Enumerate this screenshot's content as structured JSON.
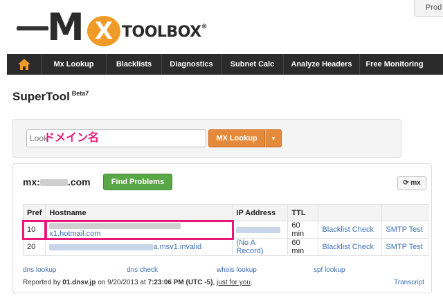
{
  "header": {
    "logo_mx": "M",
    "logo_x": "X",
    "logo_text": "TOOLBOX",
    "logo_reg": "®",
    "prod_button": "Prod"
  },
  "nav": {
    "items": [
      "Mx Lookup",
      "Blacklists",
      "Diagnostics",
      "Subnet Calc",
      "Analyze Headers",
      "Free Monitoring"
    ]
  },
  "page": {
    "title": "SuperTool",
    "beta": "Beta7"
  },
  "search": {
    "placeholder": "Look",
    "overlay_label": "ドメイン名",
    "button_label": "MX Lookup",
    "caret": "▾"
  },
  "results": {
    "domain_prefix": "mx:",
    "domain_suffix": ".com",
    "find_button": "Find Problems",
    "refresh_label": "mx",
    "columns": [
      "Pref",
      "Hostname",
      "IP Address",
      "TTL",
      "",
      ""
    ],
    "rows": [
      {
        "pref": "10",
        "hostname_visible": "x1.hotmail.com",
        "ip": "",
        "ttl": "60 min",
        "blacklist": "Blacklist Check",
        "smtp": "SMTP Test"
      },
      {
        "pref": "20",
        "hostname_visible": "a.msv1.invalid",
        "ip": "(No A Record)",
        "ttl": "60 min",
        "blacklist": "Blacklist Check",
        "smtp": "SMTP Test"
      }
    ],
    "footer_links": [
      "dns lookup",
      "dns check",
      "whois lookup",
      "spf lookup"
    ],
    "reported_prefix": "Reported by ",
    "reported_server": "01.dnsv.jp",
    "reported_on": " on 9/20/2013 at ",
    "reported_time": "7:23:06 PM (UTC -5)",
    "reported_comma": ", ",
    "reported_just": "just for you",
    "reported_end": ".",
    "transcript": "Transcript"
  },
  "colors": {
    "accent_orange": "#e5893a",
    "green": "#5aa747",
    "highlight_pink": "#e8177b",
    "nav_bg": "#2b2b2b",
    "link": "#3b6fb6"
  }
}
